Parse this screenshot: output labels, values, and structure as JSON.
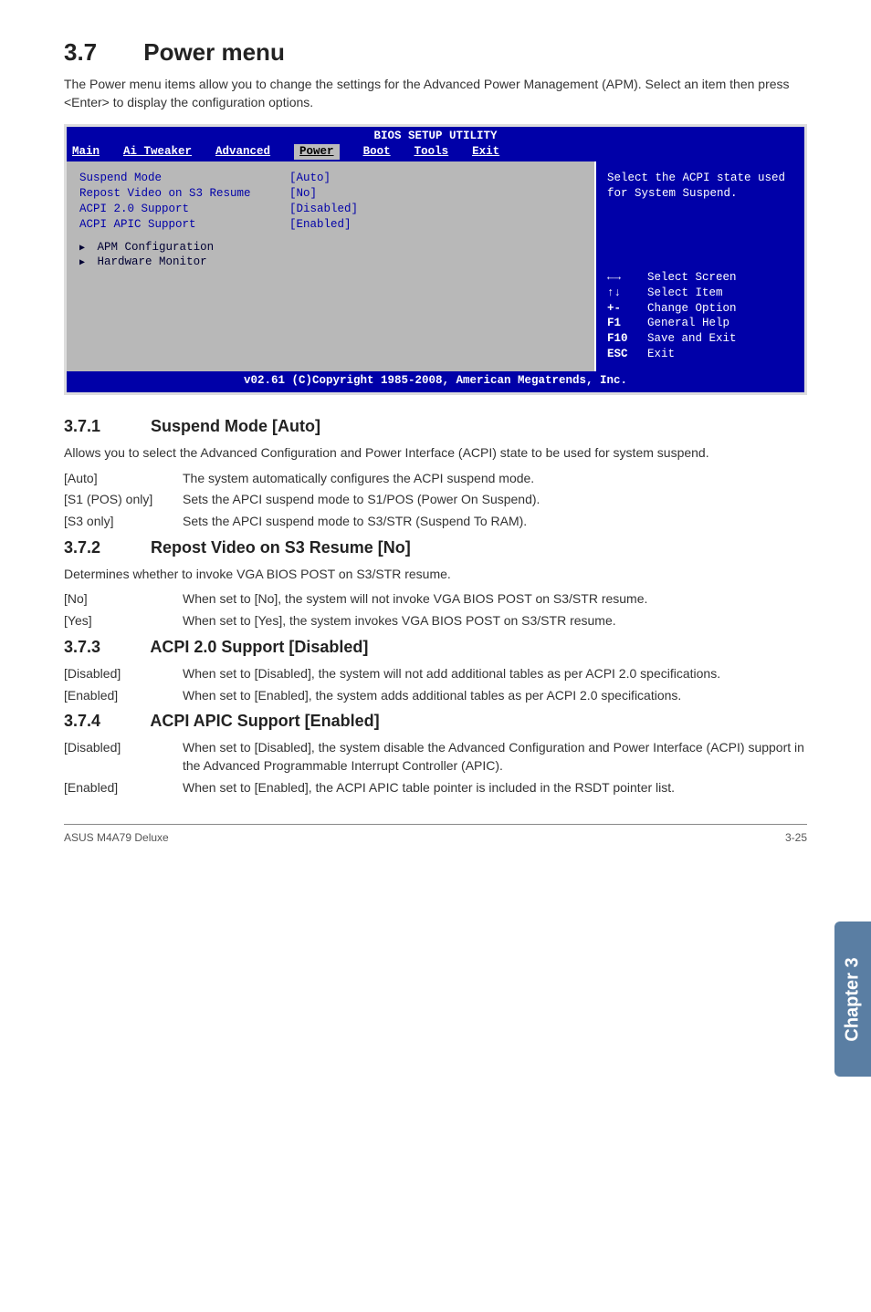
{
  "section": {
    "number": "3.7",
    "title": "Power menu"
  },
  "intro": "The Power menu items allow you to change the settings for the Advanced Power Management (APM). Select an item then press <Enter> to display the configuration options.",
  "bios": {
    "title": "BIOS SETUP UTILITY",
    "menus": {
      "m1": "Main",
      "m2": "Ai Tweaker",
      "m3": "Advanced",
      "m4": "Power",
      "m5": "Boot",
      "m6": "Tools",
      "m7": "Exit"
    },
    "items": {
      "r1l": "Suspend Mode",
      "r1v": "[Auto]",
      "r2l": "Repost Video on S3 Resume",
      "r2v": "[No]",
      "r3l": "ACPI 2.0 Support",
      "r3v": "[Disabled]",
      "r4l": "ACPI APIC Support",
      "r4v": "[Enabled]",
      "s1": "APM Configuration",
      "s2": "Hardware Monitor"
    },
    "help": "Select the ACPI state used for System Suspend.",
    "legend": {
      "l1k": "←→",
      "l1v": "Select Screen",
      "l2k": "↑↓",
      "l2v": "Select Item",
      "l3k": "+-",
      "l3v": "Change Option",
      "l4k": "F1",
      "l4v": "General Help",
      "l5k": "F10",
      "l5v": "Save and Exit",
      "l6k": "ESC",
      "l6v": "Exit"
    },
    "footer": "v02.61 (C)Copyright 1985-2008, American Megatrends, Inc."
  },
  "s371": {
    "num": "3.7.1",
    "title": "Suspend Mode [Auto]",
    "body": "Allows you to select the Advanced Configuration and Power Interface (ACPI) state to be used for system suspend.",
    "o1k": "[Auto]",
    "o1v": "The system automatically configures the ACPI suspend mode.",
    "o2k": "[S1 (POS) only]",
    "o2v": "Sets the APCI suspend mode to S1/POS (Power On Suspend).",
    "o3k": "[S3 only]",
    "o3v": "Sets the APCI suspend mode to S3/STR (Suspend To RAM)."
  },
  "s372": {
    "num": "3.7.2",
    "title": "Repost Video on S3 Resume [No]",
    "body": "Determines whether to invoke VGA BIOS POST on S3/STR resume.",
    "o1k": "[No]",
    "o1v": "When set to [No], the system will not invoke VGA BIOS POST on S3/STR resume.",
    "o2k": "[Yes]",
    "o2v": "When set to [Yes], the system invokes VGA BIOS POST on S3/STR resume."
  },
  "s373": {
    "num": "3.7.3",
    "title": "ACPI 2.0 Support [Disabled]",
    "o1k": "[Disabled]",
    "o1v": "When set to [Disabled], the system will not add additional tables as per ACPI 2.0 specifications.",
    "o2k": "[Enabled]",
    "o2v": "When set to [Enabled], the system adds additional tables as per ACPI 2.0 specifications."
  },
  "s374": {
    "num": "3.7.4",
    "title": "ACPI APIC Support [Enabled]",
    "o1k": "[Disabled]",
    "o1v": "When set to [Disabled], the system disable the Advanced Configuration and Power Interface (ACPI) support in the Advanced Programmable Interrupt Controller (APIC).",
    "o2k": "[Enabled]",
    "o2v": "When set to [Enabled], the ACPI APIC table pointer is included in the RSDT pointer list."
  },
  "sidetab": "Chapter 3",
  "footer": {
    "left": "ASUS M4A79 Deluxe",
    "right": "3-25"
  }
}
